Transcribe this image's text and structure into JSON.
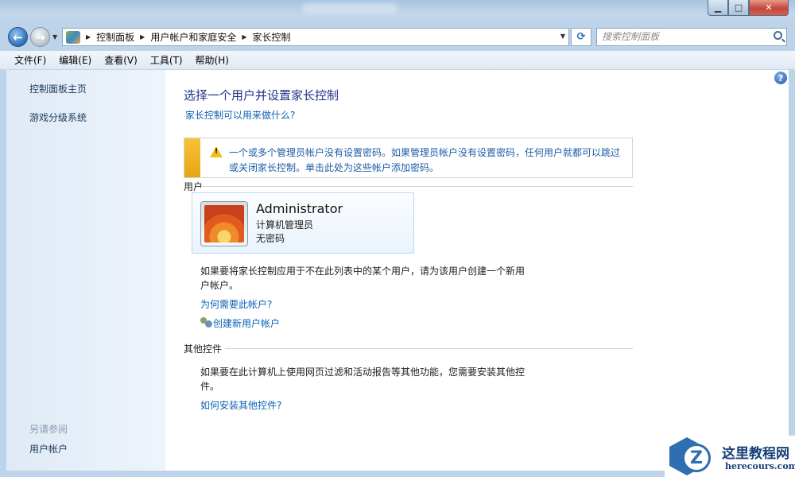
{
  "window": {
    "controls": {
      "minimize": "▁",
      "maximize": "□",
      "close": "✕"
    }
  },
  "address": {
    "back_icon": "arrow-left-icon",
    "forward_icon": "arrow-right-icon",
    "breadcrumbs": [
      "控制面板",
      "用户帐户和家庭安全",
      "家长控制"
    ],
    "search_placeholder": "搜索控制面板"
  },
  "menu": [
    "文件(F)",
    "编辑(E)",
    "查看(V)",
    "工具(T)",
    "帮助(H)"
  ],
  "sidebar": {
    "links": [
      "控制面板主页",
      "游戏分级系统"
    ],
    "see_also_heading": "另请参阅",
    "see_also_links": [
      "用户帐户"
    ]
  },
  "main": {
    "title": "选择一个用户并设置家长控制",
    "what_can_do_link": "家长控制可以用来做什么?",
    "warning": {
      "line1": "一个或多个管理员帐户没有设置密码。如果管理员帐户没有设置密码，任何用户就都可以跳过",
      "line2": "或关闭家长控制。单击此处为这些帐户添加密码。"
    },
    "users_section": "用户",
    "user": {
      "name": "Administrator",
      "role": "计算机管理员",
      "password": "无密码"
    },
    "not_in_list_text": "如果要将家长控制应用于不在此列表中的某个用户，请为该用户创建一个新用户帐户。",
    "why_need_link": "为何需要此帐户?",
    "create_account_link": "创建新用户帐户",
    "other_controls_section": "其他控件",
    "other_controls_text": "如果要在此计算机上使用网页过滤和活动报告等其他功能，您需要安装其他控件。",
    "how_install_link": "如何安装其他控件?"
  },
  "watermark": {
    "logo_letter": "Z",
    "title": "这里教程网",
    "url": "herecours.com"
  }
}
